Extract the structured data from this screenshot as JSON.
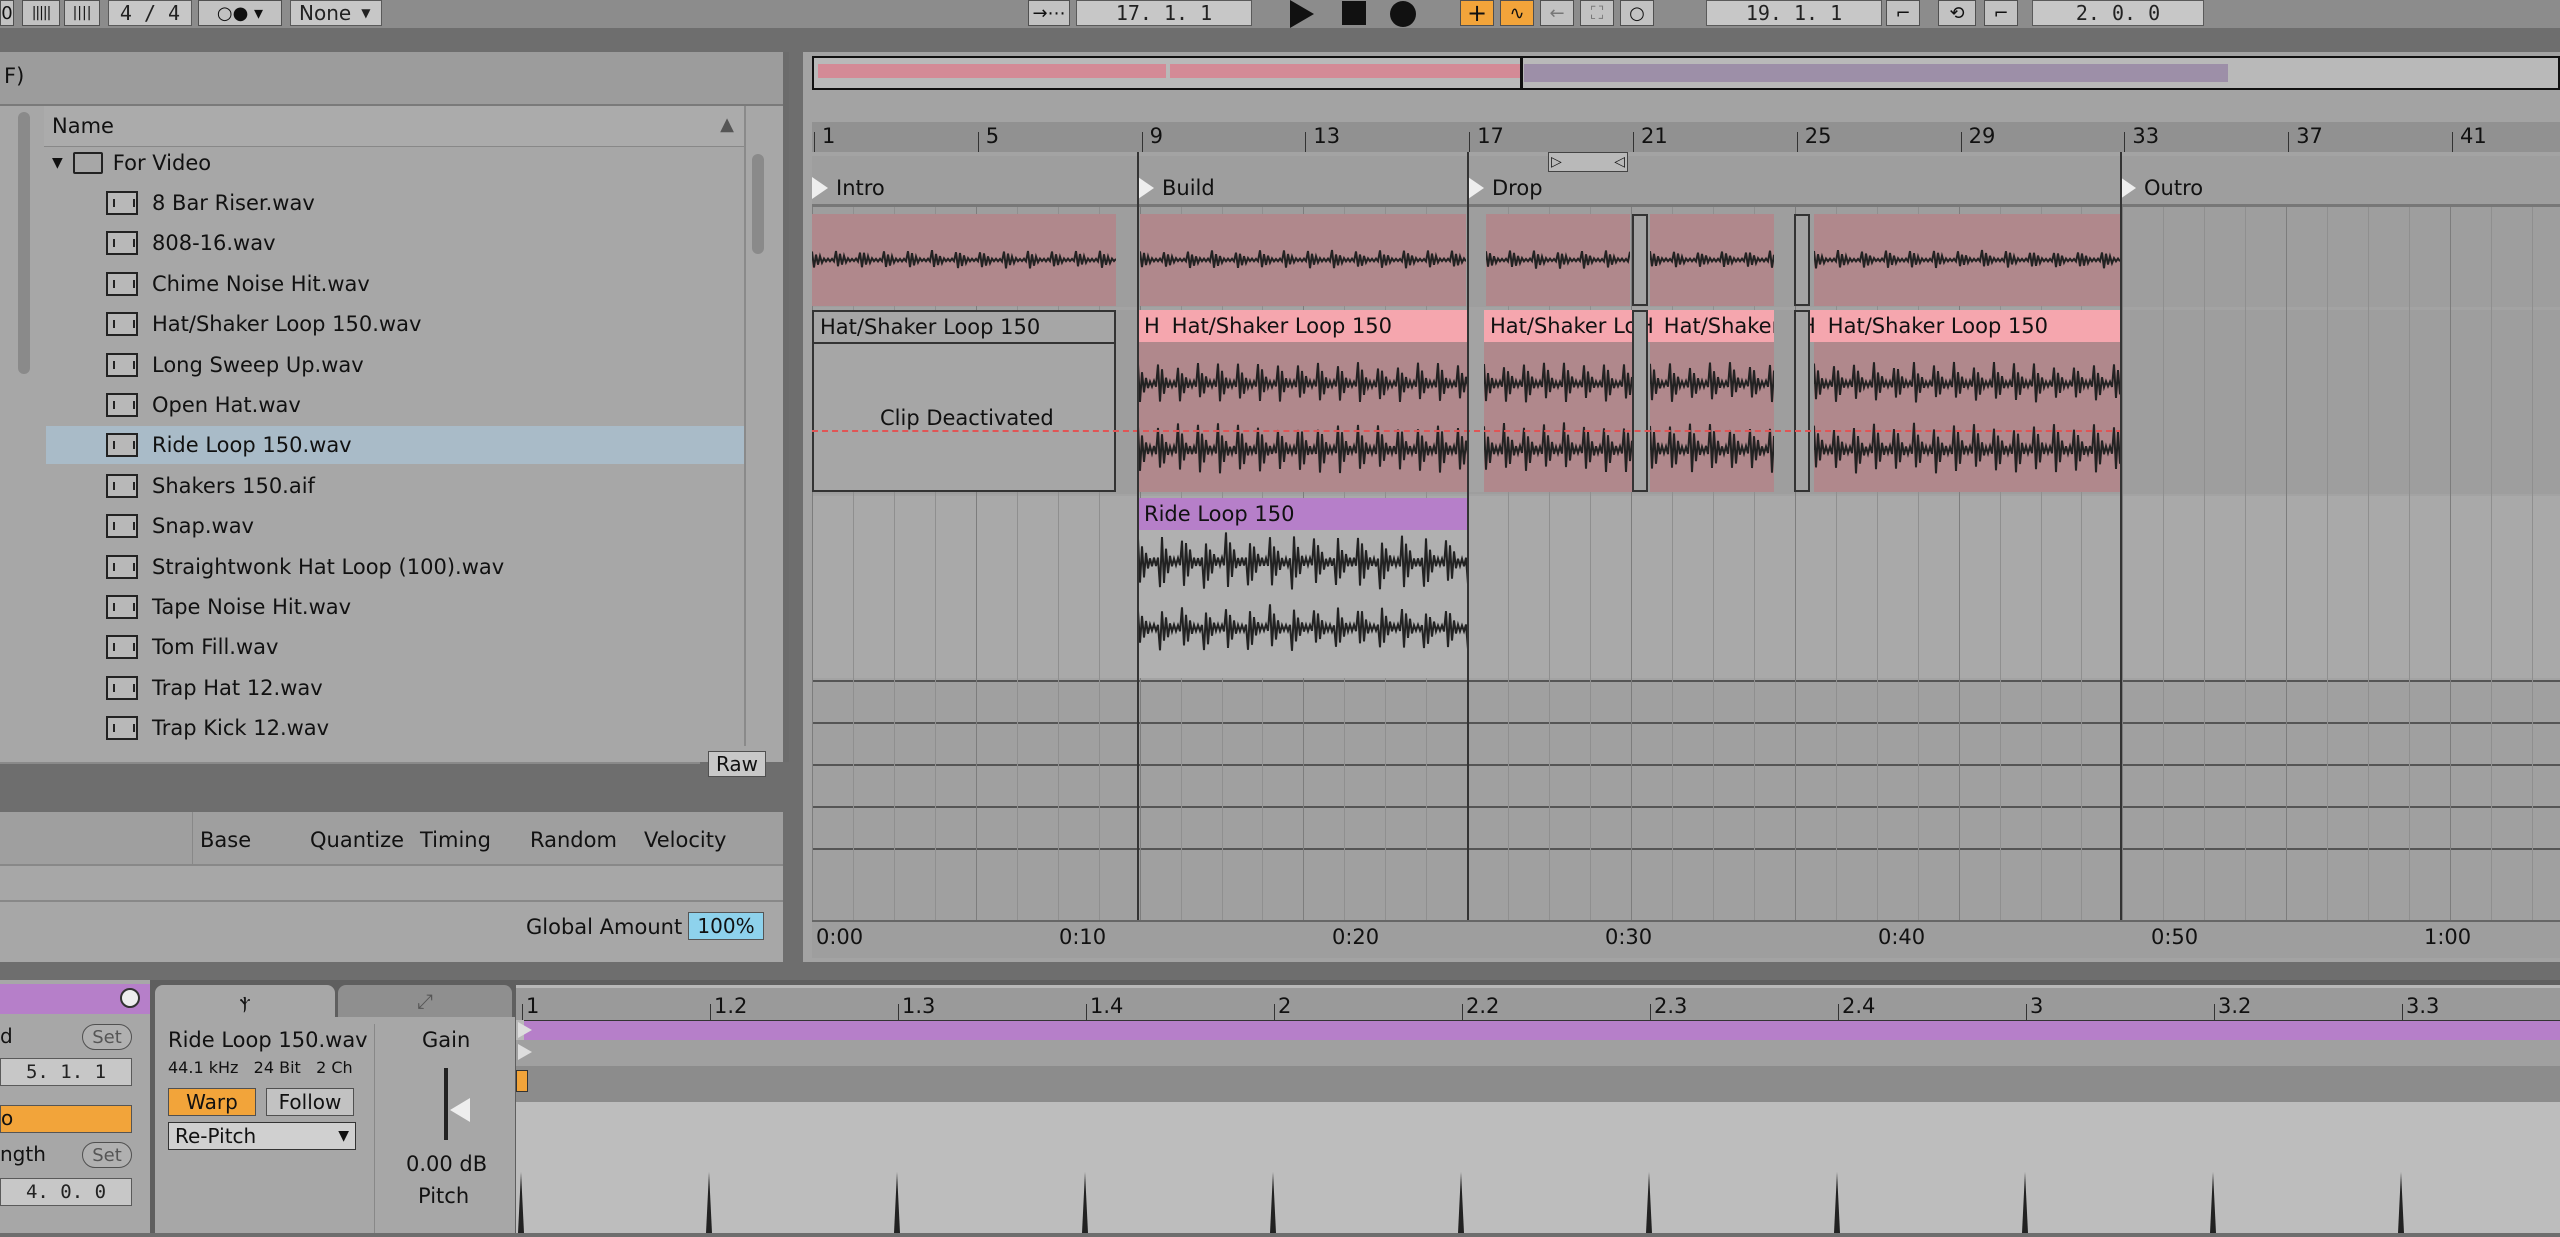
{
  "transport": {
    "time_sig": "4 / 4",
    "quantize": "None",
    "arrangement_position": "17.   1.   1",
    "loop_start": "19.   1.   1",
    "loop_length": "2.   0.   0"
  },
  "browser": {
    "header_fragment": "F)",
    "column_name": "Name",
    "folder": "For Video",
    "items": [
      {
        "label": "8 Bar Riser.wav",
        "selected": false
      },
      {
        "label": "808-16.wav",
        "selected": false
      },
      {
        "label": "Chime Noise Hit.wav",
        "selected": false
      },
      {
        "label": "Hat/Shaker Loop 150.wav",
        "selected": false
      },
      {
        "label": "Long Sweep Up.wav",
        "selected": false
      },
      {
        "label": "Open Hat.wav",
        "selected": false
      },
      {
        "label": "Ride Loop 150.wav",
        "selected": true
      },
      {
        "label": "Shakers 150.aif",
        "selected": false
      },
      {
        "label": "Snap.wav",
        "selected": false
      },
      {
        "label": "Straightwonk Hat Loop (100).wav",
        "selected": false
      },
      {
        "label": "Tape Noise Hit.wav",
        "selected": false
      },
      {
        "label": "Tom Fill.wav",
        "selected": false
      },
      {
        "label": "Trap Hat 12.wav",
        "selected": false
      },
      {
        "label": "Trap Kick 12.wav",
        "selected": false
      }
    ],
    "raw_label": "Raw"
  },
  "groove": {
    "headers": [
      "Base",
      "Quantize",
      "Timing",
      "Random",
      "Velocity"
    ],
    "global_amount_label": "Global Amount",
    "global_amount_value": "100%"
  },
  "arrangement": {
    "bar_numbers": [
      "1",
      "5",
      "9",
      "13",
      "17",
      "21",
      "25",
      "29",
      "33",
      "37",
      "41"
    ],
    "locators": [
      "Intro",
      "Build",
      "Drop",
      "Outro"
    ],
    "clips": {
      "hat_deactivated_name": "Hat/Shaker Loop 150",
      "deactivated_text": "Clip Deactivated",
      "hat_clip_a": "Hat/Shaker Loop 150",
      "hat_clip_a_prefix": "H",
      "hat_clip_b": "Hat/Shaker Lo",
      "hat_clip_c": "Hat/Shaker",
      "hat_clip_c_prefix": "H",
      "hat_clip_d": "Hat/Shaker Loop 150",
      "hat_clip_d_prefix": "H",
      "ride_clip": "Ride Loop 150"
    },
    "time_labels": [
      "0:00",
      "0:10",
      "0:20",
      "0:30",
      "0:40",
      "0:50",
      "1:00"
    ]
  },
  "detail": {
    "left": {
      "set1": "Set",
      "position": "5.   1.   1",
      "length_label": "ngth",
      "set2": "Set",
      "length_value": "4.   0.   0",
      "d_label": "d"
    },
    "sample": {
      "name": "Ride Loop 150.wav",
      "info": "44.1 kHz   24 Bit   2 Ch",
      "warp": "Warp",
      "follow": "Follow",
      "warp_mode": "Re-Pitch",
      "gain_label": "Gain",
      "gain_value": "0.00 dB",
      "pitch_label": "Pitch"
    },
    "editor_ticks": [
      "1",
      "1.2",
      "1.3",
      "1.4",
      "2",
      "2.2",
      "2.3",
      "2.4",
      "3",
      "3.2",
      "3.3"
    ]
  },
  "colors": {
    "accent_orange": "#f2a43a",
    "clip_pink": "#f5a6ae",
    "clip_purple": "#b67fc9",
    "selection_blue": "#a9bbc8"
  }
}
